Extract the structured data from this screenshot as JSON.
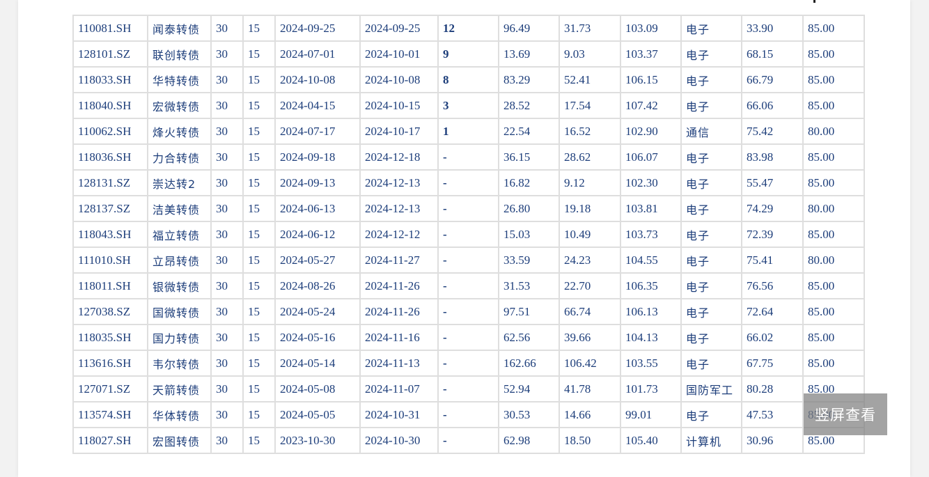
{
  "colors": {
    "cell_text": "#1c3d7a",
    "grid_border": "#dedede",
    "background": "#f2f2f2",
    "overlay_button": "#808080"
  },
  "overlay": {
    "portrait_view_label": "竖屏查看"
  },
  "rows": [
    [
      "110081.SH",
      "闻泰转债",
      "30",
      "15",
      "2024-09-25",
      "2024-09-25",
      "12",
      "96.49",
      "31.73",
      "103.09",
      "电子",
      "33.90",
      "85.00"
    ],
    [
      "128101.SZ",
      "联创转债",
      "30",
      "15",
      "2024-07-01",
      "2024-10-01",
      "9",
      "13.69",
      "9.03",
      "103.37",
      "电子",
      "68.15",
      "85.00"
    ],
    [
      "118033.SH",
      "华特转债",
      "30",
      "15",
      "2024-10-08",
      "2024-10-08",
      "8",
      "83.29",
      "52.41",
      "106.15",
      "电子",
      "66.79",
      "85.00"
    ],
    [
      "118040.SH",
      "宏微转债",
      "30",
      "15",
      "2024-04-15",
      "2024-10-15",
      "3",
      "28.52",
      "17.54",
      "107.42",
      "电子",
      "66.06",
      "85.00"
    ],
    [
      "110062.SH",
      "烽火转债",
      "30",
      "15",
      "2024-07-17",
      "2024-10-17",
      "1",
      "22.54",
      "16.52",
      "102.90",
      "通信",
      "75.42",
      "80.00"
    ],
    [
      "118036.SH",
      "力合转债",
      "30",
      "15",
      "2024-09-18",
      "2024-12-18",
      "-",
      "36.15",
      "28.62",
      "106.07",
      "电子",
      "83.98",
      "85.00"
    ],
    [
      "128131.SZ",
      "崇达转2",
      "30",
      "15",
      "2024-09-13",
      "2024-12-13",
      "-",
      "16.82",
      "9.12",
      "102.30",
      "电子",
      "55.47",
      "85.00"
    ],
    [
      "128137.SZ",
      "洁美转债",
      "30",
      "15",
      "2024-06-13",
      "2024-12-13",
      "-",
      "26.80",
      "19.18",
      "103.81",
      "电子",
      "74.29",
      "80.00"
    ],
    [
      "118043.SH",
      "福立转债",
      "30",
      "15",
      "2024-06-12",
      "2024-12-12",
      "-",
      "15.03",
      "10.49",
      "103.73",
      "电子",
      "72.39",
      "85.00"
    ],
    [
      "111010.SH",
      "立昂转债",
      "30",
      "15",
      "2024-05-27",
      "2024-11-27",
      "-",
      "33.59",
      "24.23",
      "104.55",
      "电子",
      "75.41",
      "80.00"
    ],
    [
      "118011.SH",
      "银微转债",
      "30",
      "15",
      "2024-08-26",
      "2024-11-26",
      "-",
      "31.53",
      "22.70",
      "106.35",
      "电子",
      "76.56",
      "85.00"
    ],
    [
      "127038.SZ",
      "国微转债",
      "30",
      "15",
      "2024-05-24",
      "2024-11-26",
      "-",
      "97.51",
      "66.74",
      "106.13",
      "电子",
      "72.64",
      "85.00"
    ],
    [
      "118035.SH",
      "国力转债",
      "30",
      "15",
      "2024-05-16",
      "2024-11-16",
      "-",
      "62.56",
      "39.66",
      "104.13",
      "电子",
      "66.02",
      "85.00"
    ],
    [
      "113616.SH",
      "韦尔转债",
      "30",
      "15",
      "2024-05-14",
      "2024-11-13",
      "-",
      "162.66",
      "106.42",
      "103.55",
      "电子",
      "67.75",
      "85.00"
    ],
    [
      "127071.SZ",
      "天箭转债",
      "30",
      "15",
      "2024-05-08",
      "2024-11-07",
      "-",
      "52.94",
      "41.78",
      "101.73",
      "国防军工",
      "80.28",
      "85.00"
    ],
    [
      "113574.SH",
      "华体转债",
      "30",
      "15",
      "2024-05-05",
      "2024-10-31",
      "-",
      "30.53",
      "14.66",
      "99.01",
      "电子",
      "47.53",
      "85.00"
    ],
    [
      "118027.SH",
      "宏图转债",
      "30",
      "15",
      "2023-10-30",
      "2024-10-30",
      "-",
      "62.98",
      "18.50",
      "105.40",
      "计算机",
      "30.96",
      "85.00"
    ]
  ]
}
